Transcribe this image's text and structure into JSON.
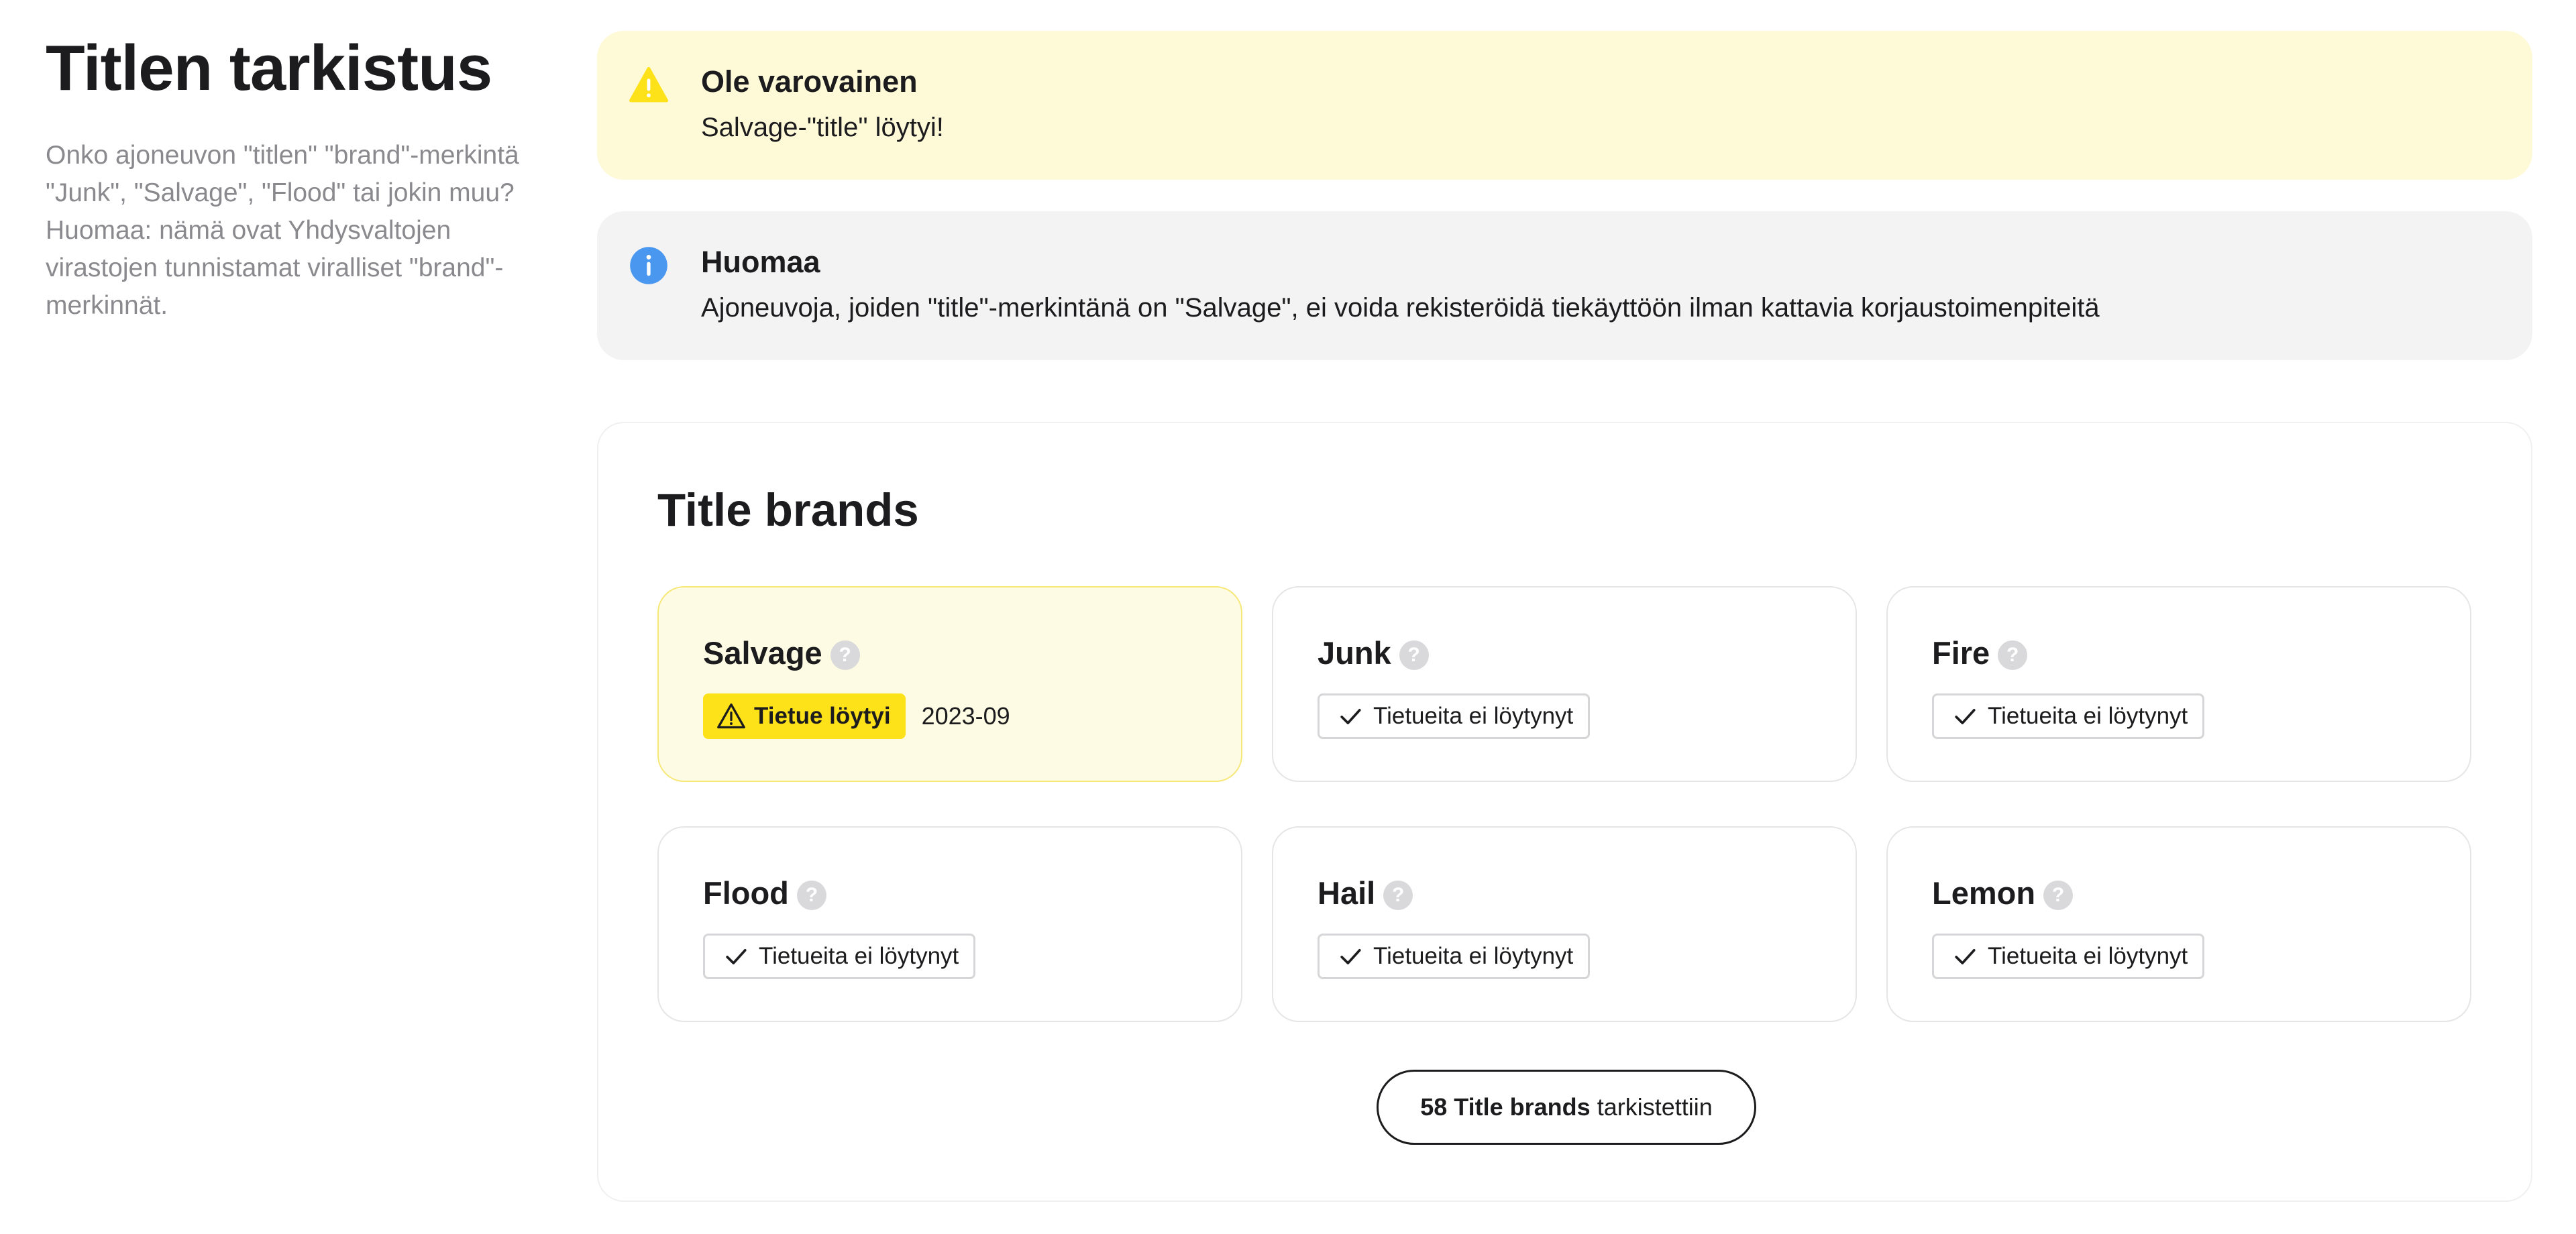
{
  "sidebar": {
    "title": "Titlen tarkistus",
    "description": "Onko ajoneuvon \"titlen\" \"brand\"-merkintä \"Junk\", \"Salvage\", \"Flood\" tai jokin muu? Huomaa: nämä ovat Yhdysvaltojen virastojen tunnistamat viralliset \"brand\"-merkinnät."
  },
  "alerts": {
    "warning": {
      "title": "Ole varovainen",
      "text": "Salvage-\"title\" löytyi!",
      "icon": "warning-icon",
      "color": "#fde21a"
    },
    "info": {
      "title": "Huomaa",
      "text": "Ajoneuvoja, joiden \"title\"-merkintänä on \"Salvage\", ei voida rekisteröidä tiekäyttöön ilman kattavia korjaustoimenpiteitä",
      "icon": "info-icon",
      "color": "#4a97f0"
    }
  },
  "brands": {
    "title": "Title brands",
    "items": [
      {
        "name": "Salvage",
        "help": "?",
        "status": "Tietue löytyi",
        "date": "2023-09"
      },
      {
        "name": "Junk",
        "help": "?",
        "status": "Tietueita ei löytynyt"
      },
      {
        "name": "Fire",
        "help": "?",
        "status": "Tietueita ei löytynyt"
      },
      {
        "name": "Flood",
        "help": "?",
        "status": "Tietueita ei löytynyt"
      },
      {
        "name": "Hail",
        "help": "?",
        "status": "Tietueita ei löytynyt"
      },
      {
        "name": "Lemon",
        "help": "?",
        "status": "Tietueita ei löytynyt"
      }
    ],
    "checked_count": "58 Title brands",
    "checked_suffix": "tarkistettiin"
  }
}
